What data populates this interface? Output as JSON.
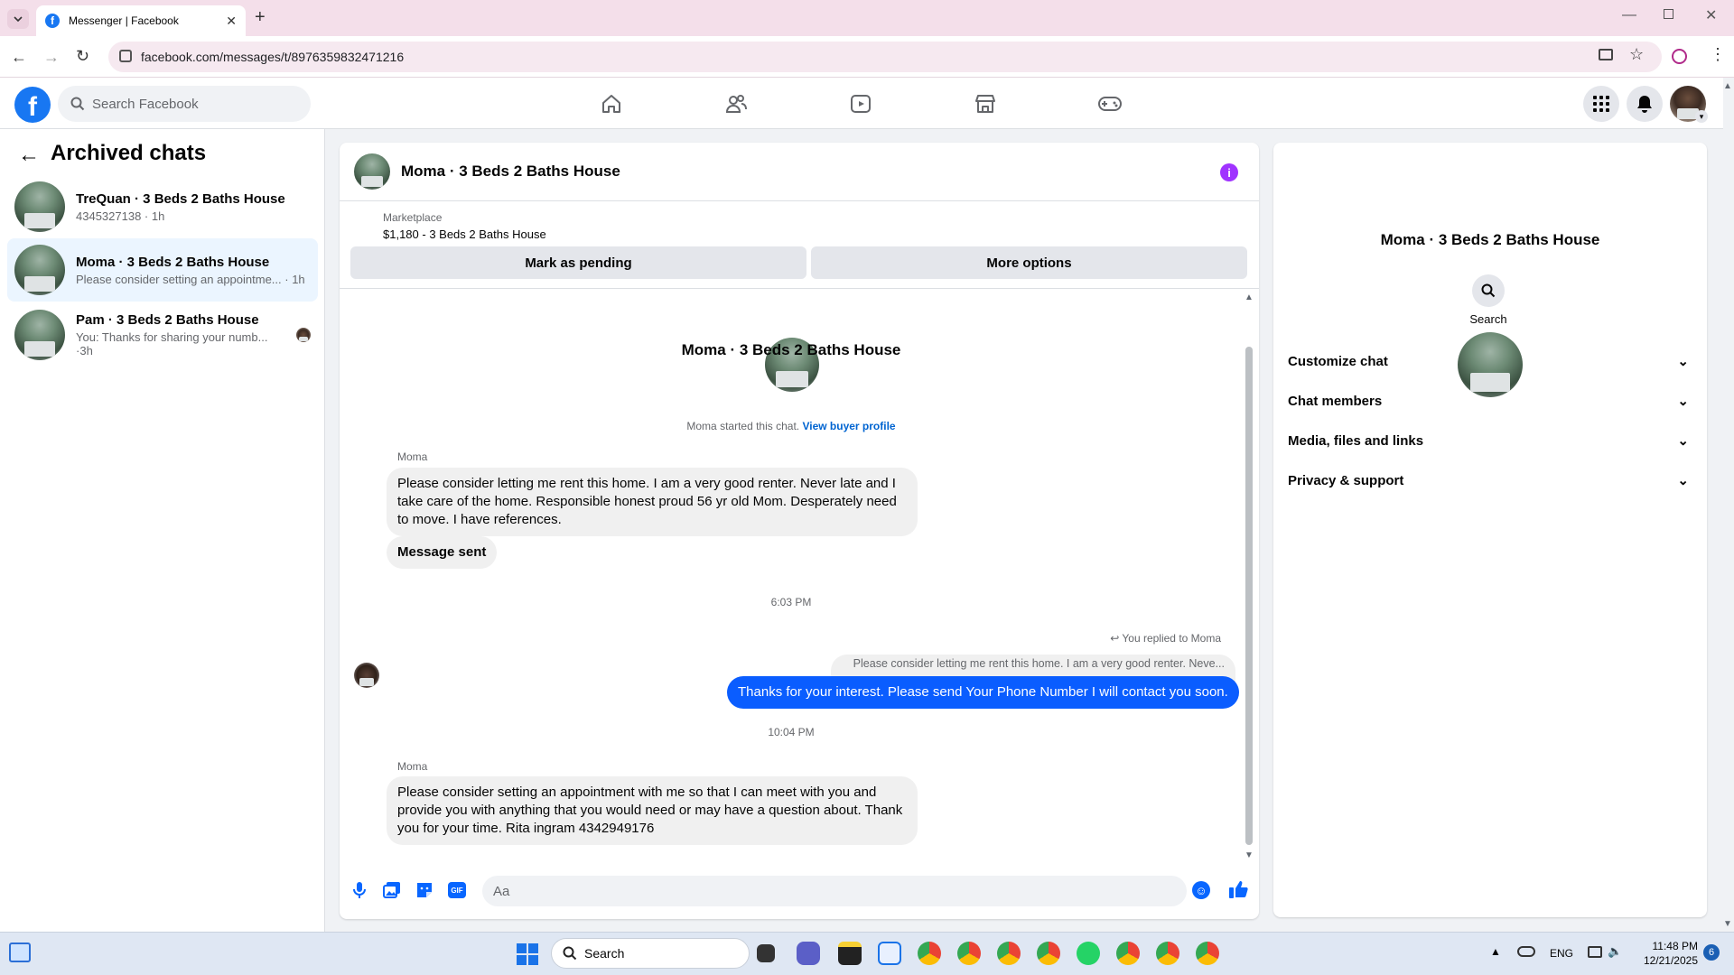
{
  "browser": {
    "tab_title": "Messenger | Facebook",
    "url": "facebook.com/messages/t/8976359832471216"
  },
  "fb": {
    "search_placeholder": "Search Facebook"
  },
  "left": {
    "title": "Archived chats",
    "chats": [
      {
        "name": "TreQuan · 3 Beds 2 Baths House",
        "preview": "4345327138 · 1h"
      },
      {
        "name": "Moma · 3 Beds 2 Baths House",
        "preview": "Please consider setting an appointme...",
        "time": "1h"
      },
      {
        "name": "Pam · 3 Beds 2 Baths House",
        "preview": "You: Thanks for sharing your numb...",
        "time": "3h"
      }
    ]
  },
  "conversation": {
    "title": "Moma · 3 Beds 2 Baths House",
    "marketplace_label": "Marketplace",
    "listing": "$1,180 - 3 Beds 2 Baths House",
    "mark_pending": "Mark as pending",
    "more_options": "More options",
    "intro_name": "Moma · 3 Beds 2 Baths House",
    "started": "Moma started this chat.",
    "view_profile": "View buyer profile",
    "sender1": "Moma",
    "msg1": "Please consider letting me rent this home. I am a very good renter. Never late and I take care of the home. Responsible honest proud 56 yr old Mom. Desperately need to move. I have references.",
    "msg2": "Message sent",
    "time1": "6:03 PM",
    "replied_to": "You replied to Moma",
    "quoted": "Please consider letting me rent this home. I am a very good renter. Neve...",
    "my_msg": "Thanks for your  interest. Please send Your Phone Number I will contact you soon.",
    "time2": "10:04 PM",
    "sender2": "Moma",
    "msg3": "Please consider setting an appointment with me so  that I can meet with you and provide you with anything that you would need or may have a question about. Thank you for  your time. Rita ingram 4342949176",
    "composer_placeholder": "Aa"
  },
  "right": {
    "name": "Moma · 3 Beds 2 Baths House",
    "search_label": "Search",
    "sections": [
      "Customize chat",
      "Chat members",
      "Media, files and links",
      "Privacy & support"
    ]
  },
  "taskbar": {
    "search_label": "Search",
    "lang": "ENG",
    "time": "11:48 PM",
    "date": "12/21/2025",
    "notif_count": "6"
  },
  "colors": {
    "accent": "#0a5dff",
    "fb_blue": "#1877f2",
    "info_purple": "#a033ff"
  }
}
